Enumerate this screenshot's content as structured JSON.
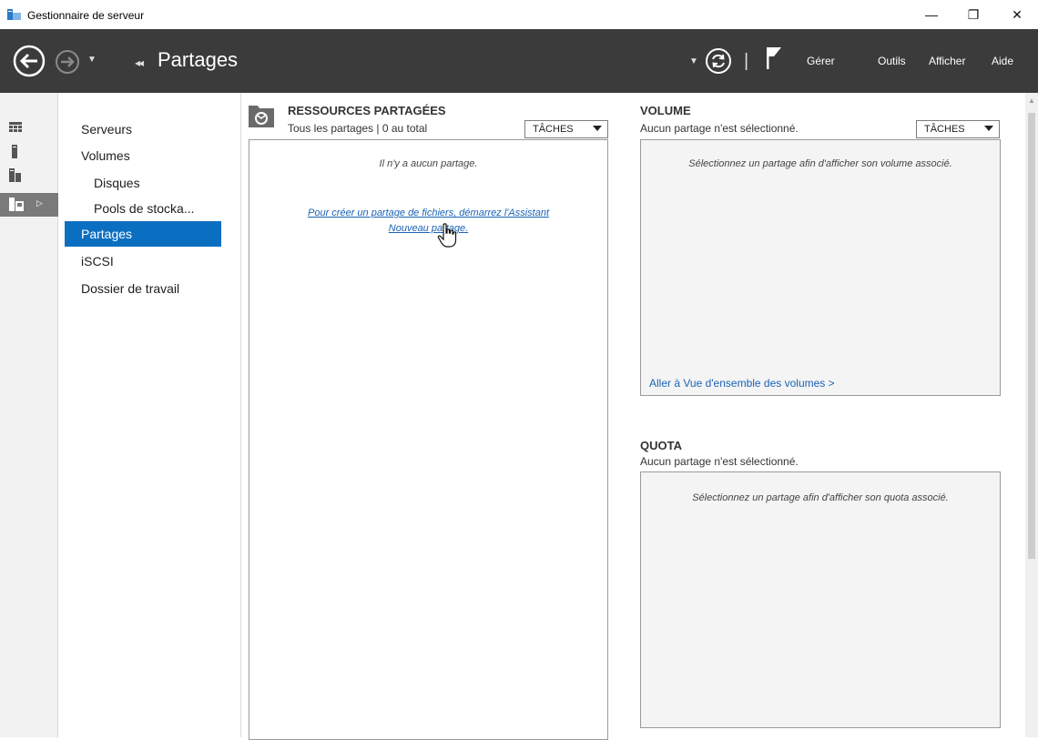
{
  "window": {
    "title": "Gestionnaire de serveur",
    "controls": {
      "minimize": "—",
      "restore": "❐",
      "close": "✕"
    }
  },
  "header": {
    "breadcrumb_arrows": "◂◂",
    "page_title": "Partages",
    "separator": "|",
    "menu": [
      {
        "label": "Gérer"
      },
      {
        "label": "Outils"
      },
      {
        "label": "Afficher"
      },
      {
        "label": "Aide"
      }
    ]
  },
  "sidebar": {
    "items": [
      {
        "label": "Serveurs",
        "sub": false,
        "selected": false
      },
      {
        "label": "Volumes",
        "sub": false,
        "selected": false
      },
      {
        "label": "Disques",
        "sub": true,
        "selected": false
      },
      {
        "label": "Pools de stocka...",
        "sub": true,
        "selected": false
      },
      {
        "label": "Partages",
        "sub": false,
        "selected": true
      },
      {
        "label": "iSCSI",
        "sub": false,
        "selected": false
      },
      {
        "label": "Dossier de travail",
        "sub": false,
        "selected": false
      }
    ]
  },
  "shares": {
    "title": "RESSOURCES PARTAGÉES",
    "subtitle": "Tous les partages | 0 au total",
    "tasks_label": "TÂCHES",
    "empty_message": "Il n'y a aucun partage.",
    "wizard_link_line1": "Pour créer un partage de fichiers, démarrez l'Assistant",
    "wizard_link_line2": "Nouveau partage."
  },
  "volume": {
    "title": "VOLUME",
    "subtitle": "Aucun partage n'est sélectionné.",
    "tasks_label": "TÂCHES",
    "message": "Sélectionnez un partage afin d'afficher son volume associé.",
    "overview_link": "Aller à Vue d'ensemble des volumes >"
  },
  "quota": {
    "title": "QUOTA",
    "subtitle": "Aucun partage n'est sélectionné.",
    "message": "Sélectionnez un partage afin d'afficher son quota associé."
  },
  "colors": {
    "header_bg": "#3b3b3b",
    "selected_bg": "#0b6fc1",
    "link": "#1a63b5",
    "panel_bg": "#f4f4f4"
  }
}
